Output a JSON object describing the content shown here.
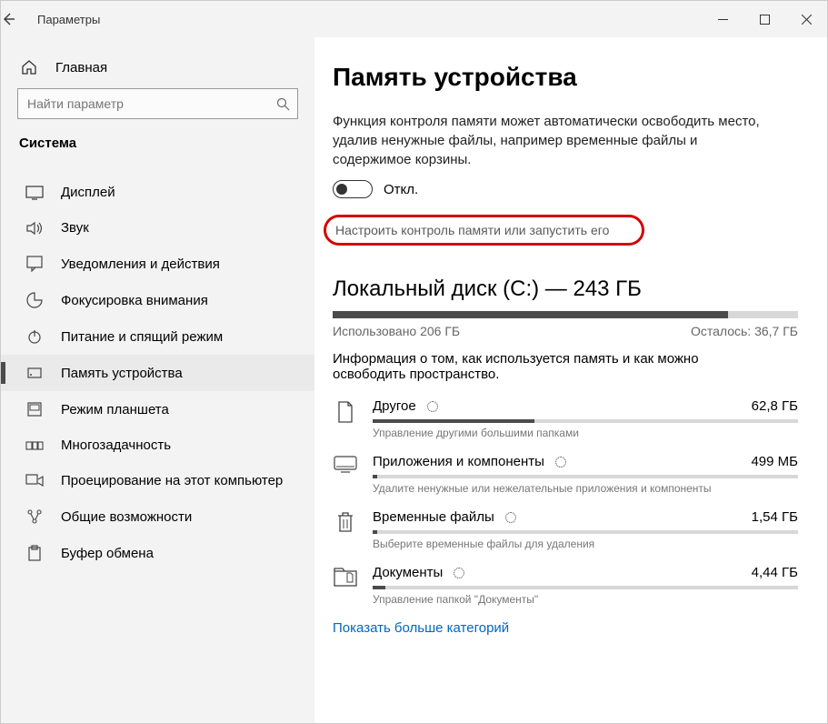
{
  "window": {
    "title": "Параметры"
  },
  "sidebar": {
    "home": "Главная",
    "search_placeholder": "Найти параметр",
    "section": "Система",
    "items": [
      {
        "label": "Дисплей"
      },
      {
        "label": "Звук"
      },
      {
        "label": "Уведомления и действия"
      },
      {
        "label": "Фокусировка внимания"
      },
      {
        "label": "Питание и спящий режим"
      },
      {
        "label": "Память устройства"
      },
      {
        "label": "Режим планшета"
      },
      {
        "label": "Многозадачность"
      },
      {
        "label": "Проецирование на этот компьютер"
      },
      {
        "label": "Общие возможности"
      },
      {
        "label": "Буфер обмена"
      }
    ]
  },
  "main": {
    "title": "Память устройства",
    "description": "Функция контроля памяти может автоматически освободить место, удалив ненужные файлы, например временные файлы и содержимое корзины.",
    "toggle_label": "Откл.",
    "configure_link": "Настроить контроль памяти или запустить его",
    "disk": {
      "title": "Локальный диск (C:) — 243 ГБ",
      "used_label": "Использовано 206 ГБ",
      "free_label": "Осталось: 36,7 ГБ",
      "info": "Информация о том, как используется память и как можно освободить пространство."
    },
    "categories": [
      {
        "name": "Другое",
        "size": "62,8 ГБ",
        "hint": "Управление другими большими папками",
        "fill": 38
      },
      {
        "name": "Приложения и компоненты",
        "size": "499 МБ",
        "hint": "Удалите ненужные или нежелательные приложения и компоненты",
        "fill": 1
      },
      {
        "name": "Временные файлы",
        "size": "1,54 ГБ",
        "hint": "Выберите временные файлы для удаления",
        "fill": 1
      },
      {
        "name": "Документы",
        "size": "4,44 ГБ",
        "hint": "Управление папкой \"Документы\"",
        "fill": 3
      }
    ],
    "show_more": "Показать больше категорий"
  }
}
